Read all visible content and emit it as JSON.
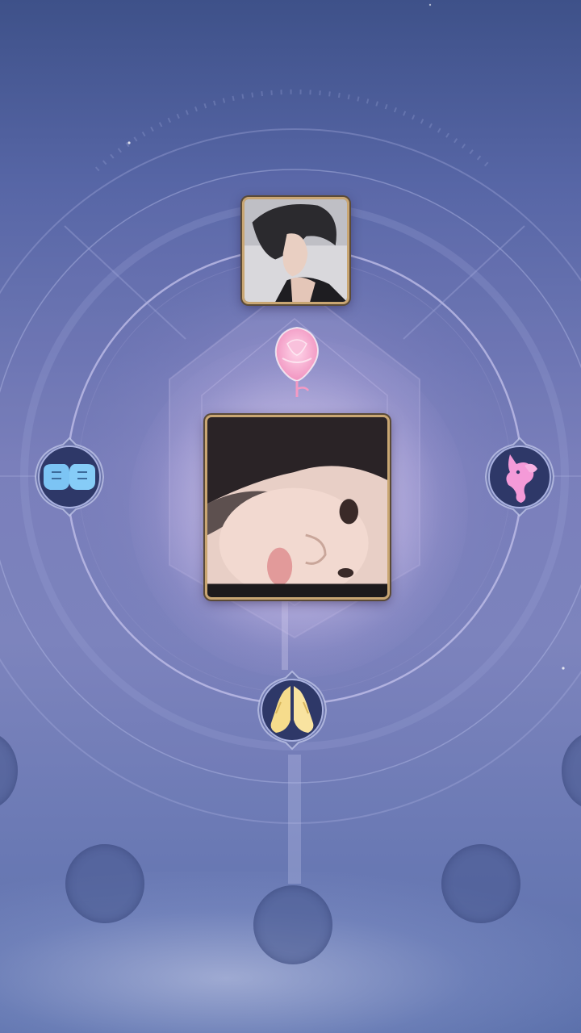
{
  "scene": {
    "background_top": "#3e5189",
    "background_mid": "#7a80bb",
    "frame_gold": "#c9a673"
  },
  "portraits": {
    "top": {
      "icon": "dark-haired-character-portrait-icon"
    },
    "main": {
      "icon": "player-face-portrait-icon"
    }
  },
  "emblems": {
    "left": {
      "icon": "fist-bump-icon",
      "color": "#7cc4f4"
    },
    "right": {
      "icon": "unicorn-icon",
      "color": "#f49ad8"
    },
    "bottom": {
      "icon": "praying-hands-icon",
      "color": "#f6dc8c"
    },
    "rose": {
      "icon": "rose-icon",
      "color": "#f7a3c8"
    }
  },
  "slots": {
    "count": 5
  }
}
